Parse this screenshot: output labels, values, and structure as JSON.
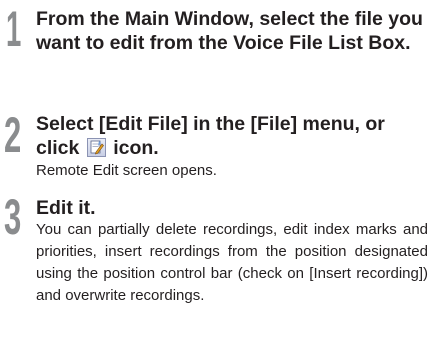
{
  "steps": [
    {
      "number": "1",
      "heading": "From the Main Window, select the file you want to edit from the Voice File List Box."
    },
    {
      "number": "2",
      "heading_before_icon": "Select [Edit File] in the [File] menu, or click",
      "heading_after_icon": "icon.",
      "icon": "edit-file-icon",
      "body": "Remote Edit screen opens."
    },
    {
      "number": "3",
      "heading": "Edit it.",
      "body": "You can partially delete recordings, edit index marks and priorities, insert recordings from the position designated using the position control bar (check on [Insert recording]) and overwrite recordings."
    }
  ]
}
